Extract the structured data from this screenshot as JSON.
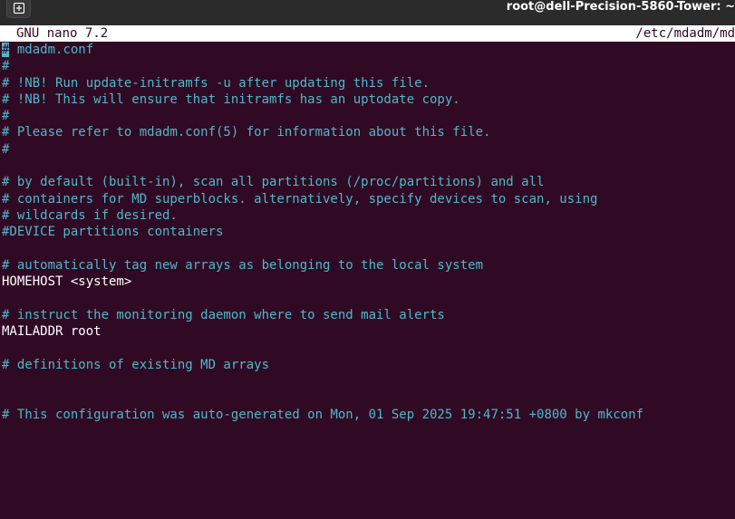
{
  "window": {
    "title": "root@dell-Precision-5860-Tower: ~"
  },
  "nano": {
    "version": "GNU nano 7.2",
    "filename": "/etc/mdadm/md"
  },
  "editor": {
    "lines": [
      {
        "text": "# mdadm.conf",
        "kind": "comment"
      },
      {
        "text": "#",
        "kind": "comment"
      },
      {
        "text": "# !NB! Run update-initramfs -u after updating this file.",
        "kind": "comment"
      },
      {
        "text": "# !NB! This will ensure that initramfs has an uptodate copy.",
        "kind": "comment"
      },
      {
        "text": "#",
        "kind": "comment"
      },
      {
        "text": "# Please refer to mdadm.conf(5) for information about this file.",
        "kind": "comment"
      },
      {
        "text": "#",
        "kind": "comment"
      },
      {
        "text": "",
        "kind": "plain"
      },
      {
        "text": "# by default (built-in), scan all partitions (/proc/partitions) and all",
        "kind": "comment"
      },
      {
        "text": "# containers for MD superblocks. alternatively, specify devices to scan, using",
        "kind": "comment"
      },
      {
        "text": "# wildcards if desired.",
        "kind": "comment"
      },
      {
        "text": "#DEVICE partitions containers",
        "kind": "comment"
      },
      {
        "text": "",
        "kind": "plain"
      },
      {
        "text": "# automatically tag new arrays as belonging to the local system",
        "kind": "comment"
      },
      {
        "text": "HOMEHOST <system>",
        "kind": "plain"
      },
      {
        "text": "",
        "kind": "plain"
      },
      {
        "text": "# instruct the monitoring daemon where to send mail alerts",
        "kind": "comment"
      },
      {
        "text": "MAILADDR root",
        "kind": "plain"
      },
      {
        "text": "",
        "kind": "plain"
      },
      {
        "text": "# definitions of existing MD arrays",
        "kind": "comment"
      },
      {
        "text": "",
        "kind": "plain"
      },
      {
        "text": "",
        "kind": "plain"
      },
      {
        "text": "# This configuration was auto-generated on Mon, 01 Sep 2025 19:47:51 +0800 by mkconf",
        "kind": "comment"
      }
    ]
  },
  "colors": {
    "background": "#300a24",
    "comment": "#4eb8c7",
    "text": "#ffffff",
    "header_bg": "#ffffff"
  }
}
